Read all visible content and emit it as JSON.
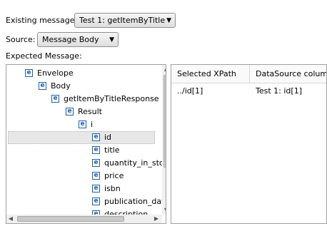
{
  "existing_message": {
    "label": "Existing message:",
    "value": "Test 1: getItemByTitle"
  },
  "source": {
    "label": "Source:",
    "value": "Message Body"
  },
  "expected_label": "Expected Message:",
  "tree": [
    {
      "label": "Envelope"
    },
    {
      "label": "Body"
    },
    {
      "label": "getItemByTitleResponse"
    },
    {
      "label": "Result"
    },
    {
      "label": "i"
    },
    {
      "label": "id",
      "selected": true
    },
    {
      "label": "title"
    },
    {
      "label": "quantity_in_stock"
    },
    {
      "label": "price"
    },
    {
      "label": "isbn"
    },
    {
      "label": "publication_date"
    },
    {
      "label": "description"
    }
  ],
  "icon_names": {
    "element": "xml-element-icon"
  },
  "table": {
    "columns": [
      "Selected XPath",
      "DataSource column"
    ],
    "rows": [
      [
        "../id[1]",
        "Test 1: id[1]"
      ]
    ]
  }
}
